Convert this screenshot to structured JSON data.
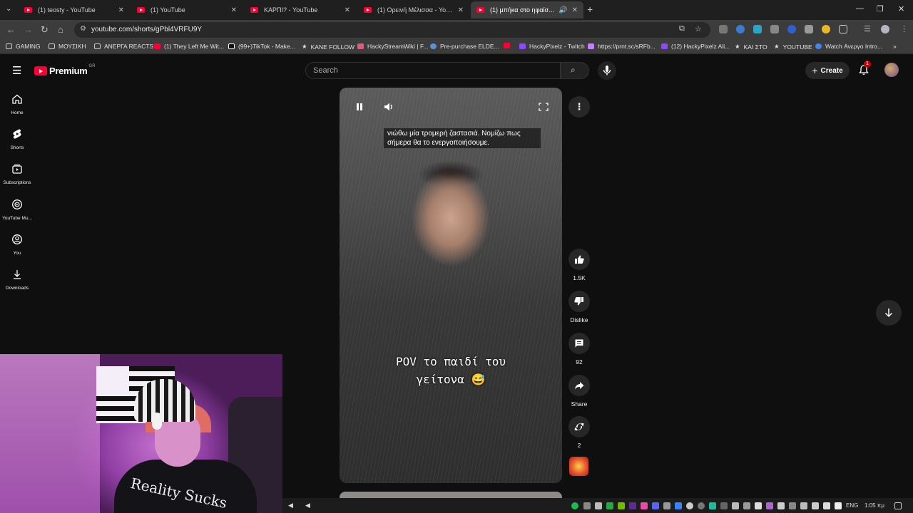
{
  "browser": {
    "tabs": [
      {
        "title": "(1) teosty - YouTube",
        "active": false
      },
      {
        "title": "(1) YouTube",
        "active": false
      },
      {
        "title": "ΚΑΡΠΙ? - YouTube",
        "active": false
      },
      {
        "title": "(1) Ορεινή Μέλισσα - YouTube",
        "active": false
      },
      {
        "title": "(1) μπήκα στο ηφαίστειο -",
        "active": true
      }
    ],
    "new_tab": "+",
    "url": "youtube.com/shorts/gPbl4VRFU9Y",
    "bookmarks": [
      {
        "label": "GAMING",
        "icon": "folder-icon"
      },
      {
        "label": "ΜΟΥΣΙΚΗ",
        "icon": "folder-icon"
      },
      {
        "label": "ΑΝΕΡΓΑ REACTS",
        "icon": "folder-icon"
      },
      {
        "label": "(1) They Left Me Wit...",
        "icon": "youtube-icon"
      },
      {
        "label": "(99+)TikTok - Make...",
        "icon": "tiktok-icon"
      },
      {
        "label": "KANE FOLLOW",
        "icon": "star-icon"
      },
      {
        "label": "HackyStreamWiki | F...",
        "icon": "wiki-icon"
      },
      {
        "label": "Pre-purchase ELDE...",
        "icon": "steam-icon"
      },
      {
        "label": "",
        "icon": "youtube-icon"
      },
      {
        "label": "HackyPixelz - Twitch",
        "icon": "twitch-icon"
      },
      {
        "label": "https://prnt.sc/sRFb...",
        "icon": "feather-icon"
      },
      {
        "label": "(12) HackyPixelz Ali...",
        "icon": "twitch-icon"
      },
      {
        "label": "ΚΑΙ ΣΤΟ",
        "icon": "star-icon"
      },
      {
        "label": "YOUTUBE",
        "icon": "star-icon"
      },
      {
        "label": "Watch Ανεργο Intro...",
        "icon": "go-icon"
      }
    ]
  },
  "youtube": {
    "logo_text": "Premium",
    "region": "GR",
    "search_placeholder": "Search",
    "create_label": "Create",
    "notification_count": "1",
    "sidebar": [
      {
        "label": "Home",
        "icon": "home-icon"
      },
      {
        "label": "Shorts",
        "icon": "shorts-icon"
      },
      {
        "label": "Subscriptions",
        "icon": "subscriptions-icon"
      },
      {
        "label": "YouTube Mu...",
        "icon": "youtube-music-icon"
      },
      {
        "label": "You",
        "icon": "you-icon"
      },
      {
        "label": "Downloads",
        "icon": "download-icon"
      }
    ],
    "video": {
      "caption_top": "νιώθω μία τρομερή ζαστασιά. Νομίζω πως σήμερα θα το ενεργοποιήσουμε.",
      "caption_main_line1": "POV το παιδί του",
      "caption_main_line2": "γείτονα 😅"
    },
    "actions": {
      "likes": "1.5K",
      "dislike_label": "Dislike",
      "comments": "92",
      "share_label": "Share",
      "remix_count": "2"
    }
  },
  "webcam": {
    "shirt_text": "Reality Sucks"
  },
  "taskbar": {
    "language": "ENG",
    "clock": "1:05 πμ"
  },
  "colors": {
    "youtube_red": "#ff0033",
    "background": "#0f0f0f",
    "chip": "#272727"
  }
}
